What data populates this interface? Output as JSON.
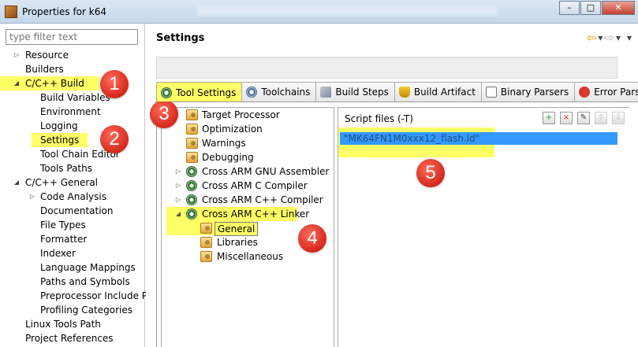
{
  "window": {
    "title": "Properties for k64",
    "buttons": {
      "minimize": "–",
      "maximize": "□",
      "close": "✕"
    }
  },
  "sidebar": {
    "filter_placeholder": "type filter text",
    "items": [
      {
        "label": "Resource",
        "twisty": "▷"
      },
      {
        "label": "Builders",
        "twisty": ""
      },
      {
        "label": "C/C++ Build",
        "twisty": "◢"
      },
      {
        "label": "Build Variables",
        "twisty": ""
      },
      {
        "label": "Environment",
        "twisty": ""
      },
      {
        "label": "Logging",
        "twisty": ""
      },
      {
        "label": "Settings",
        "twisty": ""
      },
      {
        "label": "Tool Chain Editor",
        "twisty": ""
      },
      {
        "label": "Tools Paths",
        "twisty": ""
      },
      {
        "label": "C/C++ General",
        "twisty": "◢"
      },
      {
        "label": "Code Analysis",
        "twisty": "▷"
      },
      {
        "label": "Documentation",
        "twisty": ""
      },
      {
        "label": "File Types",
        "twisty": ""
      },
      {
        "label": "Formatter",
        "twisty": ""
      },
      {
        "label": "Indexer",
        "twisty": ""
      },
      {
        "label": "Language Mappings",
        "twisty": ""
      },
      {
        "label": "Paths and Symbols",
        "twisty": ""
      },
      {
        "label": "Preprocessor Include Pa",
        "twisty": ""
      },
      {
        "label": "Profiling Categories",
        "twisty": ""
      },
      {
        "label": "Linux Tools Path",
        "twisty": ""
      },
      {
        "label": "Project References",
        "twisty": ""
      }
    ]
  },
  "main": {
    "title": "Settings",
    "nav": {
      "back": "⇦",
      "down1": "▾",
      "forward": "⇨",
      "down2": "▾",
      "menu": "▾"
    },
    "tabs": [
      {
        "label": "Tool Settings",
        "icon": "gear-icon"
      },
      {
        "label": "Toolchains",
        "icon": "chain-icon"
      },
      {
        "label": "Build Steps",
        "icon": "steps-icon"
      },
      {
        "label": "Build Artifact",
        "icon": "trophy-icon"
      },
      {
        "label": "Binary Parsers",
        "icon": "binary-icon"
      },
      {
        "label": "Error Parse",
        "icon": "error-icon"
      }
    ],
    "tool_tree": [
      {
        "label": "Target Processor"
      },
      {
        "label": "Optimization"
      },
      {
        "label": "Warnings"
      },
      {
        "label": "Debugging"
      },
      {
        "label": "Cross ARM GNU Assembler",
        "twisty": "▷"
      },
      {
        "label": "Cross ARM C Compiler",
        "twisty": "▷"
      },
      {
        "label": "Cross ARM C++ Compiler",
        "twisty": "▷"
      },
      {
        "label": "Cross ARM C++ Linker",
        "twisty": "◢"
      },
      {
        "label": "General"
      },
      {
        "label": "Libraries"
      },
      {
        "label": "Miscellaneous"
      }
    ],
    "script_panel": {
      "label": "Script files (-T)",
      "tools": {
        "add": "+",
        "delete": "×",
        "edit": "✎",
        "up": "⇧",
        "down": "⇩"
      },
      "files": [
        "\"MK64FN1M0xxx12_flash.ld\""
      ]
    }
  },
  "callouts": [
    "1",
    "2",
    "3",
    "4",
    "5"
  ],
  "colors": {
    "highlight": "#ffff66",
    "callout": "#d5281b",
    "selection": "#3399ff"
  }
}
